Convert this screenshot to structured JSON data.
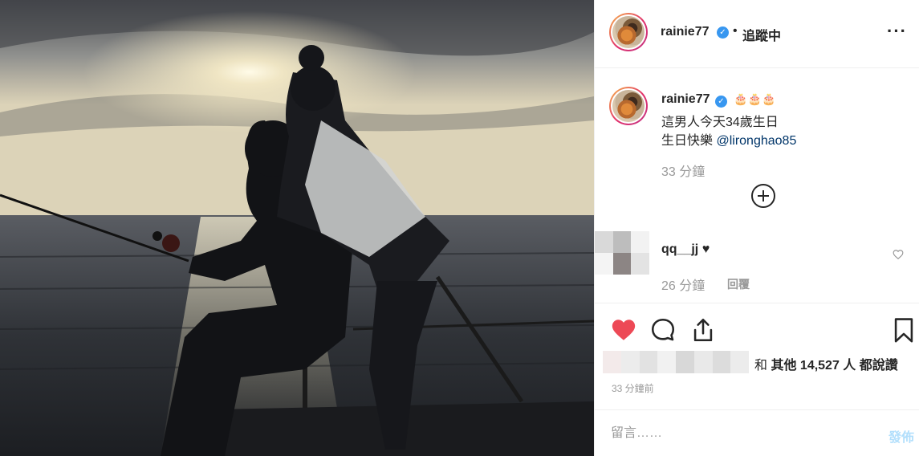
{
  "post": {
    "image_alt": "Silhouette of a couple fishing on a boat at sunset"
  },
  "header": {
    "username": "rainie77",
    "separator": "•",
    "follow_state": "追蹤中",
    "more_icon": "more-horizontal-icon"
  },
  "caption": {
    "username": "rainie77",
    "emoji": "🎂🎂🎂",
    "lines": [
      "這男人今天34歲生日",
      "生日快樂"
    ],
    "mention": "@lironghao85",
    "time": "33 分鐘"
  },
  "load_more_icon": "circle-plus-icon",
  "comment": {
    "username": "qq__jj",
    "heart": "♥",
    "time": "26 分鐘",
    "reply_label": "回覆"
  },
  "actions": {
    "like_icon": "heart-filled-icon",
    "comment_icon": "comment-bubble-icon",
    "share_icon": "share-upload-icon",
    "save_icon": "bookmark-icon",
    "like_color": "#ed4956"
  },
  "likes": {
    "prefix": "和",
    "others": "其他 14,527 人",
    "suffix": "都說讚"
  },
  "post_time": "33 分鐘前",
  "composer": {
    "placeholder": "留言……",
    "post_label": "發佈"
  }
}
